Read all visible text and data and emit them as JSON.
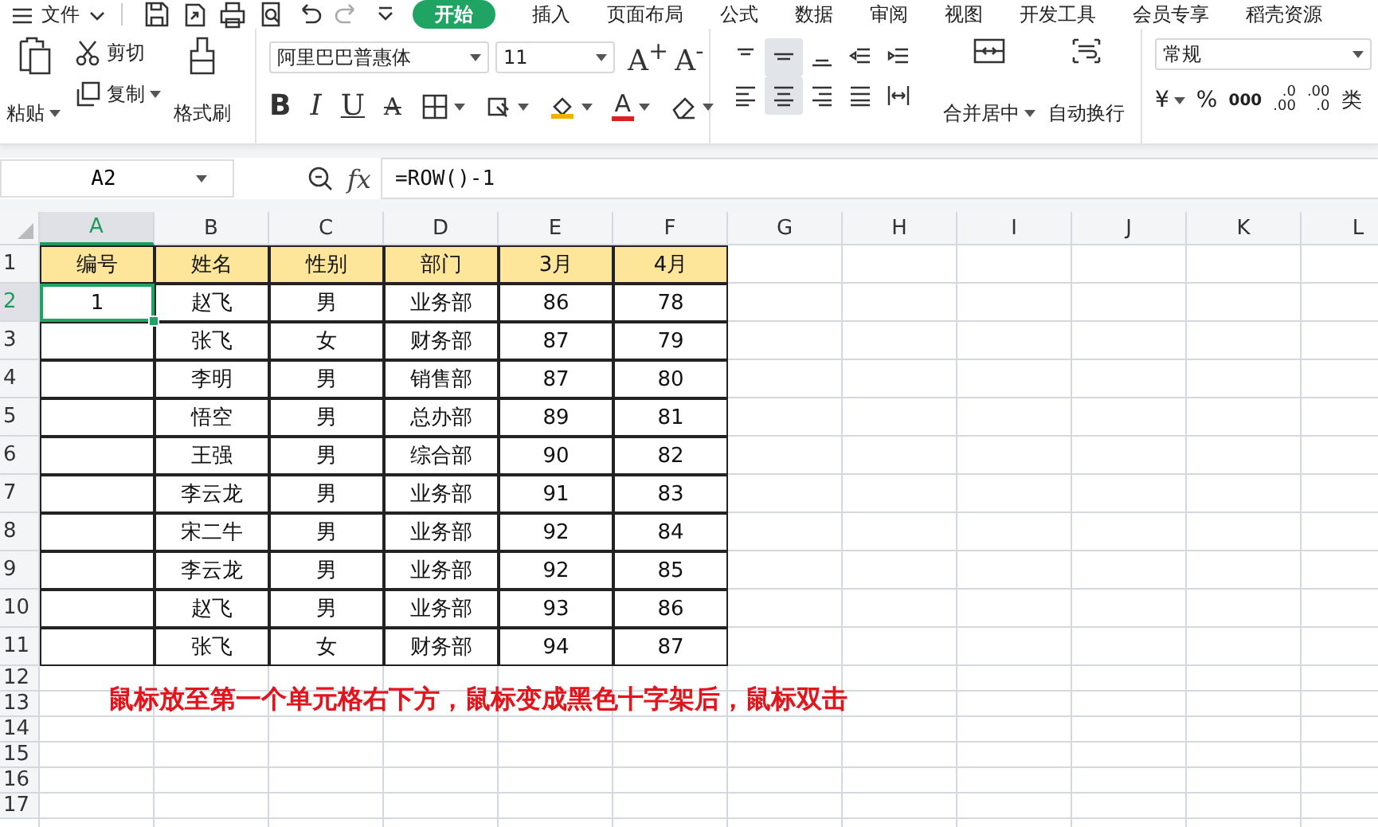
{
  "menu": {
    "file": "文件",
    "tabs": [
      {
        "label": "开始",
        "selected": true
      },
      {
        "label": "插入",
        "selected": false
      },
      {
        "label": "页面布局",
        "selected": false
      },
      {
        "label": "公式",
        "selected": false
      },
      {
        "label": "数据",
        "selected": false
      },
      {
        "label": "审阅",
        "selected": false
      },
      {
        "label": "视图",
        "selected": false
      },
      {
        "label": "开发工具",
        "selected": false
      },
      {
        "label": "会员专享",
        "selected": false
      },
      {
        "label": "稻壳资源",
        "selected": false
      }
    ]
  },
  "ribbon": {
    "clipboard": {
      "paste": "粘贴",
      "cut": "剪切",
      "copy": "复制",
      "format_painter": "格式刷"
    },
    "font": {
      "name": "阿里巴巴普惠体",
      "size": "11",
      "grow": "A$^{+}$",
      "shrink": "A$^{-}$",
      "styles": [
        "B",
        "I",
        "U"
      ],
      "strike": "A",
      "font_color_label": "A"
    },
    "alignment": {
      "top_row": [
        {
          "pressed": false
        },
        {
          "pressed": true
        },
        {
          "pressed": false
        },
        {
          "pressed": false
        },
        {
          "pressed": false
        }
      ],
      "bottom_row": [
        {
          "pressed": false
        },
        {
          "pressed": true
        },
        {
          "pressed": false
        },
        {
          "pressed": false
        },
        {
          "pressed": false
        }
      ],
      "merge": "合并居中",
      "wrap": "自动换行"
    },
    "number": {
      "format": "常规",
      "currency": "¥",
      "percent": "%",
      "thousands": "000",
      "increase_decimal": [
        ".0",
        ".00"
      ],
      "decrease_decimal": [
        ".00",
        ".0"
      ],
      "more": "类"
    }
  },
  "formula_bar": {
    "cell_ref": "A2",
    "fx": "fx",
    "formula": "=ROW()-1"
  },
  "sheet": {
    "columns": [
      {
        "label": "A",
        "selected": true
      },
      {
        "label": "B",
        "selected": false
      },
      {
        "label": "C",
        "selected": false
      },
      {
        "label": "D",
        "selected": false
      },
      {
        "label": "E",
        "selected": false
      },
      {
        "label": "F",
        "selected": false
      },
      {
        "label": "G",
        "selected": false
      },
      {
        "label": "H",
        "selected": false
      },
      {
        "label": "I",
        "selected": false
      },
      {
        "label": "J",
        "selected": false
      },
      {
        "label": "K",
        "selected": false
      },
      {
        "label": "L",
        "selected": false
      }
    ],
    "rows": [
      {
        "label": "1",
        "selected": false,
        "kind": "header",
        "cells": [
          {
            "text": "编号",
            "selected": false
          },
          {
            "text": "姓名",
            "selected": false
          },
          {
            "text": "性别",
            "selected": false
          },
          {
            "text": "部门",
            "selected": false
          },
          {
            "text": "3月",
            "selected": false
          },
          {
            "text": "4月",
            "selected": false
          }
        ]
      },
      {
        "label": "2",
        "selected": true,
        "kind": "data",
        "cells": [
          {
            "text": "1",
            "selected": true
          },
          {
            "text": "赵飞",
            "selected": false
          },
          {
            "text": "男",
            "selected": false
          },
          {
            "text": "业务部",
            "selected": false
          },
          {
            "text": "86",
            "selected": false
          },
          {
            "text": "78",
            "selected": false
          }
        ]
      },
      {
        "label": "3",
        "selected": false,
        "kind": "data",
        "cells": [
          {
            "selected": false
          },
          {
            "text": "张飞",
            "selected": false
          },
          {
            "text": "女",
            "selected": false
          },
          {
            "text": "财务部",
            "selected": false
          },
          {
            "text": "87",
            "selected": false
          },
          {
            "text": "79",
            "selected": false
          }
        ]
      },
      {
        "label": "4",
        "selected": false,
        "kind": "data",
        "cells": [
          {
            "selected": false
          },
          {
            "text": "李明",
            "selected": false
          },
          {
            "text": "男",
            "selected": false
          },
          {
            "text": "销售部",
            "selected": false
          },
          {
            "text": "87",
            "selected": false
          },
          {
            "text": "80",
            "selected": false
          }
        ]
      },
      {
        "label": "5",
        "selected": false,
        "kind": "data",
        "cells": [
          {
            "selected": false
          },
          {
            "text": "悟空",
            "selected": false
          },
          {
            "text": "男",
            "selected": false
          },
          {
            "text": "总办部",
            "selected": false
          },
          {
            "text": "89",
            "selected": false
          },
          {
            "text": "81",
            "selected": false
          }
        ]
      },
      {
        "label": "6",
        "selected": false,
        "kind": "data",
        "cells": [
          {
            "selected": false
          },
          {
            "text": "王强",
            "selected": false
          },
          {
            "text": "男",
            "selected": false
          },
          {
            "text": "综合部",
            "selected": false
          },
          {
            "text": "90",
            "selected": false
          },
          {
            "text": "82",
            "selected": false
          }
        ]
      },
      {
        "label": "7",
        "selected": false,
        "kind": "data",
        "cells": [
          {
            "selected": false
          },
          {
            "text": "李云龙",
            "selected": false
          },
          {
            "text": "男",
            "selected": false
          },
          {
            "text": "业务部",
            "selected": false
          },
          {
            "text": "91",
            "selected": false
          },
          {
            "text": "83",
            "selected": false
          }
        ]
      },
      {
        "label": "8",
        "selected": false,
        "kind": "data",
        "cells": [
          {
            "selected": false
          },
          {
            "text": "宋二牛",
            "selected": false
          },
          {
            "text": "男",
            "selected": false
          },
          {
            "text": "业务部",
            "selected": false
          },
          {
            "text": "92",
            "selected": false
          },
          {
            "text": "84",
            "selected": false
          }
        ]
      },
      {
        "label": "9",
        "selected": false,
        "kind": "data",
        "cells": [
          {
            "selected": false
          },
          {
            "text": "李云龙",
            "selected": false
          },
          {
            "text": "男",
            "selected": false
          },
          {
            "text": "业务部",
            "selected": false
          },
          {
            "text": "92",
            "selected": false
          },
          {
            "text": "85",
            "selected": false
          }
        ]
      },
      {
        "label": "10",
        "selected": false,
        "kind": "data",
        "cells": [
          {
            "selected": false
          },
          {
            "text": "赵飞",
            "selected": false
          },
          {
            "text": "男",
            "selected": false
          },
          {
            "text": "业务部",
            "selected": false
          },
          {
            "text": "93",
            "selected": false
          },
          {
            "text": "86",
            "selected": false
          }
        ]
      },
      {
        "label": "11",
        "selected": false,
        "kind": "data",
        "cells": [
          {
            "selected": false
          },
          {
            "text": "张飞",
            "selected": false
          },
          {
            "text": "女",
            "selected": false
          },
          {
            "text": "财务部",
            "selected": false
          },
          {
            "text": "94",
            "selected": false
          },
          {
            "text": "87",
            "selected": false
          }
        ]
      },
      {
        "label": "12",
        "selected": false,
        "kind": "blank"
      },
      {
        "label": "13",
        "selected": false,
        "kind": "blank"
      },
      {
        "label": "14",
        "selected": false,
        "kind": "blank"
      },
      {
        "label": "15",
        "selected": false,
        "kind": "blank"
      },
      {
        "label": "16",
        "selected": false,
        "kind": "blank"
      },
      {
        "label": "17",
        "selected": false,
        "kind": "blank"
      }
    ],
    "note": "鼠标放至第一个单元格右下方，鼠标变成黑色十字架后，鼠标双击"
  }
}
